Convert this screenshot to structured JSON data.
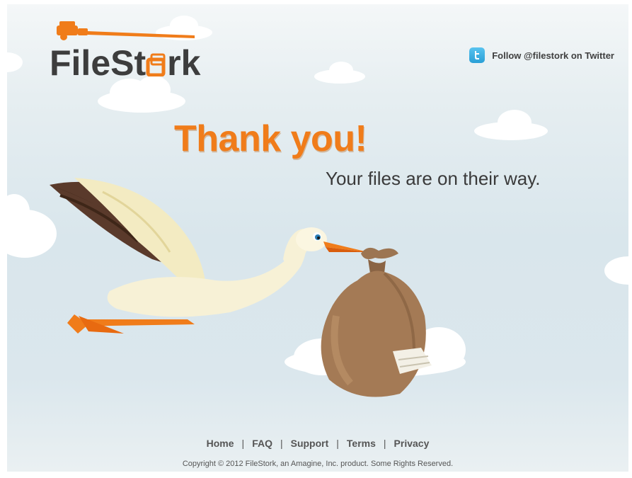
{
  "brand": {
    "logo_text_start": "FileSt",
    "logo_text_end": "rk",
    "logo_alt": "FileStork",
    "accent_color": "#f07c1a",
    "dark_color": "#3d3d3d"
  },
  "twitter": {
    "icon": "twitter-icon",
    "label": "Follow @filestork on Twitter"
  },
  "main": {
    "headline": "Thank you!",
    "subheadline": "Your files are on their way.",
    "illustration": "stork-carrying-bundle"
  },
  "footer": {
    "links": [
      {
        "label": "Home"
      },
      {
        "label": "FAQ"
      },
      {
        "label": "Support"
      },
      {
        "label": "Terms"
      },
      {
        "label": "Privacy"
      }
    ],
    "separator": "|",
    "copyright": "Copyright © 2012 FileStork, an Amagine, Inc. product. Some Rights Reserved."
  }
}
